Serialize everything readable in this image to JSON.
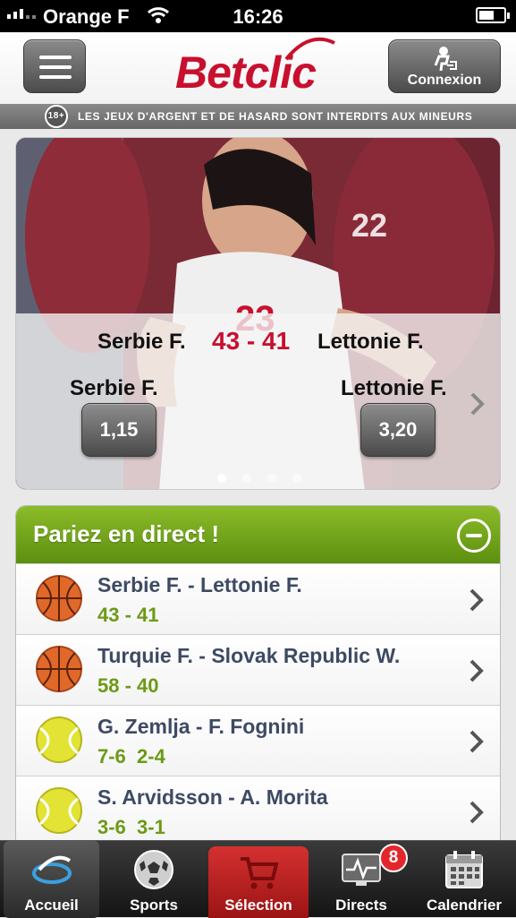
{
  "status_bar": {
    "carrier": "Orange F",
    "time": "16:26"
  },
  "header": {
    "logo_text": "Betclic",
    "connexion_label": "Connexion"
  },
  "warning": {
    "age_label": "18+",
    "text": "LES JEUX D'ARGENT ET DE HASARD SONT INTERDITS AUX MINEURS"
  },
  "hero": {
    "team_home": "Serbie F.",
    "score": "43 - 41",
    "team_away": "Lettonie F.",
    "pick_home_label": "Serbie F.",
    "pick_away_label": "Lettonie F.",
    "odds_home": "1,15",
    "odds_away": "3,20",
    "slide_count": 4,
    "active_slide": 1
  },
  "live": {
    "title": "Pariez en direct !",
    "matches": [
      {
        "sport": "basketball-icon",
        "name": "Serbie F. - Lettonie F.",
        "score": "43 - 41"
      },
      {
        "sport": "basketball-icon",
        "name": "Turquie F. - Slovak Republic W.",
        "score": "58 - 40"
      },
      {
        "sport": "tennis-ball-icon",
        "name": "G. Zemlja - F. Fognini",
        "score": "7-6  2-4"
      },
      {
        "sport": "tennis-ball-icon",
        "name": "S. Arvidsson - A. Morita",
        "score": "3-6  3-1"
      }
    ]
  },
  "tabbar": {
    "tabs": [
      {
        "label": "Accueil",
        "icon": "home-logo-icon"
      },
      {
        "label": "Sports",
        "icon": "soccer-ball-icon"
      },
      {
        "label": "Sélection",
        "icon": "cart-icon"
      },
      {
        "label": "Directs",
        "icon": "monitor-pulse-icon"
      },
      {
        "label": "Calendrier",
        "icon": "calendar-icon"
      }
    ],
    "directs_badge": "8"
  },
  "colors": {
    "brand_red": "#c8102e",
    "live_green": "#6c9a16",
    "match_blue": "#3d4a63",
    "selection_red": "#c42222"
  }
}
